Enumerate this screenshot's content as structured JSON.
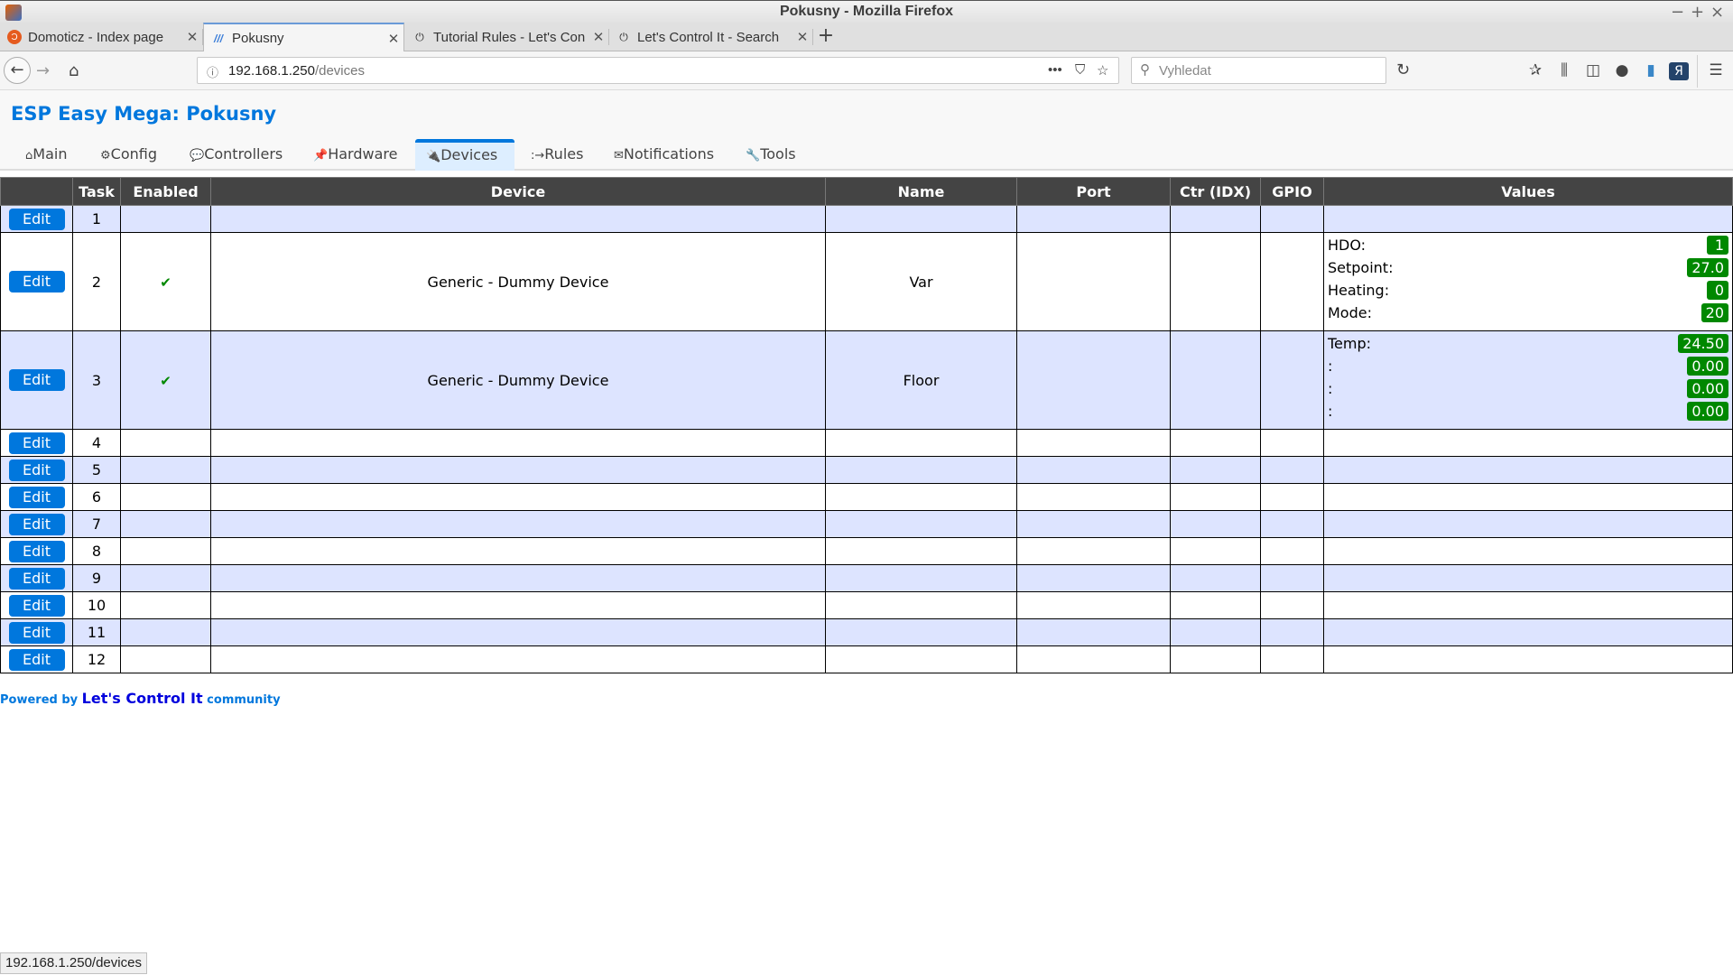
{
  "window": {
    "title": "Pokusny - Mozilla Firefox",
    "controls": [
      "−",
      "+",
      "×"
    ]
  },
  "browser_tabs": [
    {
      "label": "Domoticz - Index page",
      "favicon": "domoticz-icon",
      "active": false
    },
    {
      "label": "Pokusny",
      "favicon": "esp-easy-icon",
      "active": true
    },
    {
      "label": "Tutorial Rules - Let's Con",
      "favicon": "letscontrolit-icon",
      "active": false
    },
    {
      "label": "Let's Control It - Search",
      "favicon": "letscontrolit-icon",
      "active": false
    }
  ],
  "new_tab_label": "+",
  "address_bar": {
    "host": "192.168.1.250",
    "path": "/devices"
  },
  "search_bar": {
    "placeholder": "Vyhledat"
  },
  "page": {
    "title": "ESP Easy Mega: Pokusny",
    "menu": [
      {
        "icon": "⌂",
        "label": "Main",
        "active": false
      },
      {
        "icon": "⚙",
        "label": "Config",
        "active": false
      },
      {
        "icon": "💬",
        "label": "Controllers",
        "active": false
      },
      {
        "icon": "📌",
        "label": "Hardware",
        "active": false
      },
      {
        "icon": "🔌",
        "label": "Devices",
        "active": true
      },
      {
        "icon": ":→",
        "label": "Rules",
        "active": false
      },
      {
        "icon": "✉",
        "label": "Notifications",
        "active": false
      },
      {
        "icon": "🔧",
        "label": "Tools",
        "active": false
      }
    ]
  },
  "table": {
    "headers": [
      "",
      "Task",
      "Enabled",
      "Device",
      "Name",
      "Port",
      "Ctr (IDX)",
      "GPIO",
      "Values"
    ],
    "edit_label": "Edit",
    "check_glyph": "✔",
    "rows": [
      {
        "task": "1",
        "enabled": false,
        "device": "",
        "name": "",
        "port": "",
        "ctr": "",
        "gpio": "",
        "values": []
      },
      {
        "task": "2",
        "enabled": true,
        "device": "Generic - Dummy Device",
        "name": "Var",
        "port": "",
        "ctr": "",
        "gpio": "",
        "values": [
          {
            "name": "HDO:",
            "value": "1"
          },
          {
            "name": "Setpoint:",
            "value": "27.0"
          },
          {
            "name": "Heating:",
            "value": "0"
          },
          {
            "name": "Mode:",
            "value": "20"
          }
        ]
      },
      {
        "task": "3",
        "enabled": true,
        "device": "Generic - Dummy Device",
        "name": "Floor",
        "port": "",
        "ctr": "",
        "gpio": "",
        "values": [
          {
            "name": "Temp:",
            "value": "24.50"
          },
          {
            "name": ":",
            "value": "0.00"
          },
          {
            "name": ":",
            "value": "0.00"
          },
          {
            "name": ":",
            "value": "0.00"
          }
        ]
      },
      {
        "task": "4",
        "enabled": false,
        "device": "",
        "name": "",
        "port": "",
        "ctr": "",
        "gpio": "",
        "values": []
      },
      {
        "task": "5",
        "enabled": false,
        "device": "",
        "name": "",
        "port": "",
        "ctr": "",
        "gpio": "",
        "values": []
      },
      {
        "task": "6",
        "enabled": false,
        "device": "",
        "name": "",
        "port": "",
        "ctr": "",
        "gpio": "",
        "values": []
      },
      {
        "task": "7",
        "enabled": false,
        "device": "",
        "name": "",
        "port": "",
        "ctr": "",
        "gpio": "",
        "values": []
      },
      {
        "task": "8",
        "enabled": false,
        "device": "",
        "name": "",
        "port": "",
        "ctr": "",
        "gpio": "",
        "values": []
      },
      {
        "task": "9",
        "enabled": false,
        "device": "",
        "name": "",
        "port": "",
        "ctr": "",
        "gpio": "",
        "values": []
      },
      {
        "task": "10",
        "enabled": false,
        "device": "",
        "name": "",
        "port": "",
        "ctr": "",
        "gpio": "",
        "values": []
      },
      {
        "task": "11",
        "enabled": false,
        "device": "",
        "name": "",
        "port": "",
        "ctr": "",
        "gpio": "",
        "values": []
      },
      {
        "task": "12",
        "enabled": false,
        "device": "",
        "name": "",
        "port": "",
        "ctr": "",
        "gpio": "",
        "values": []
      }
    ]
  },
  "footer": {
    "prefix": "Powered by ",
    "brand": "Let's Control It",
    "suffix": " community"
  },
  "status_bar": "192.168.1.250/devices",
  "colors": {
    "accent": "#0077dd",
    "header_bg": "#444444",
    "odd_row": "#dde4ff",
    "value_badge": "#008800",
    "active_tab_bg": "#ddeeff"
  }
}
